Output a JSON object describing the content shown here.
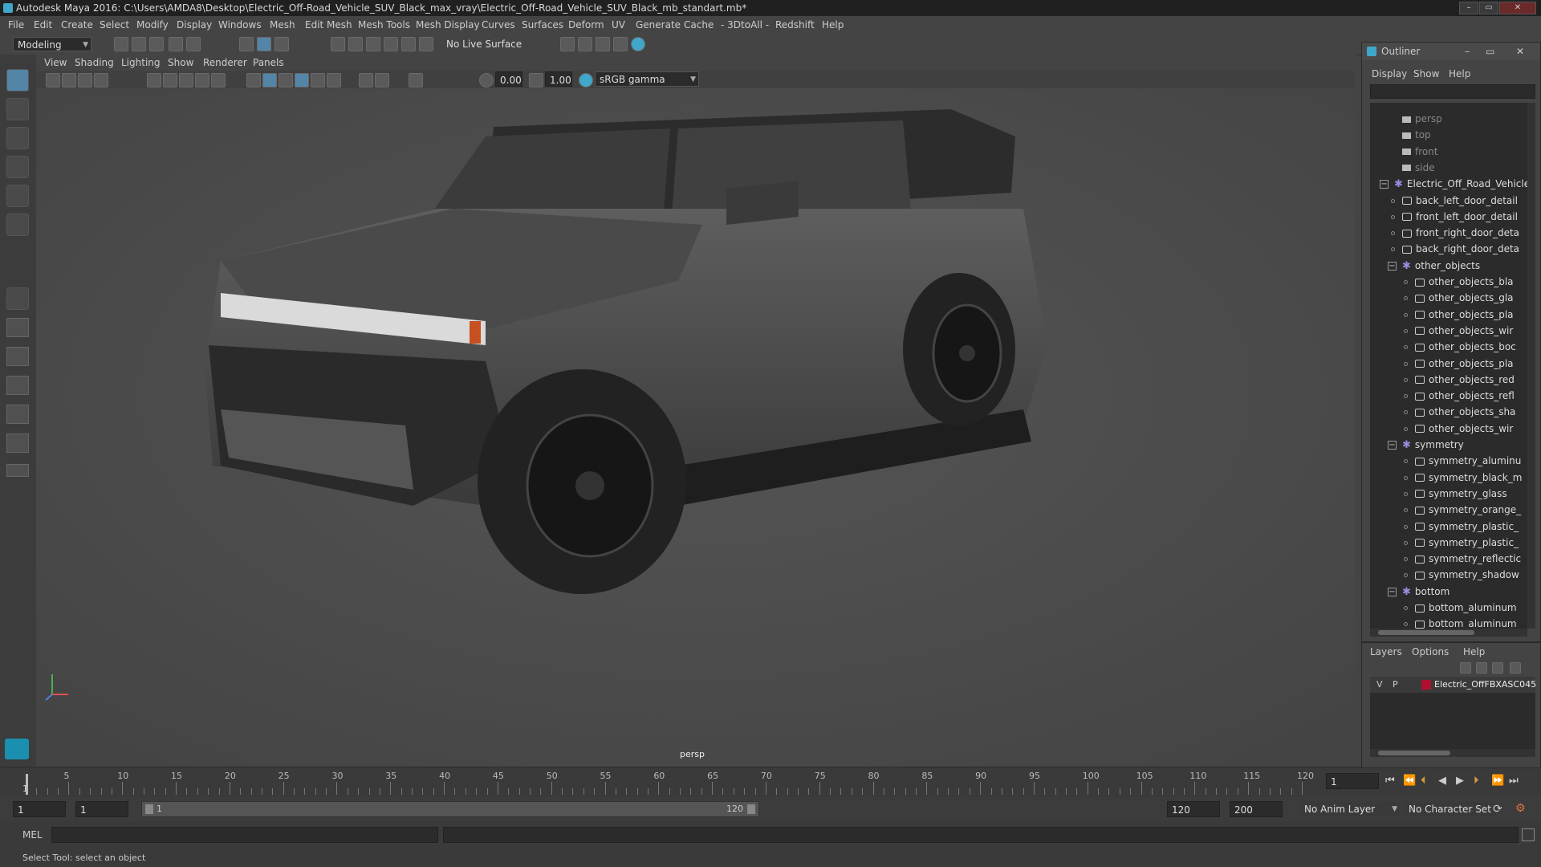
{
  "window": {
    "title": "Autodesk Maya 2016: C:\\Users\\AMDA8\\Desktop\\Electric_Off-Road_Vehicle_SUV_Black_max_vray\\Electric_Off-Road_Vehicle_SUV_Black_mb_standart.mb*"
  },
  "menu": [
    "File",
    "Edit",
    "Create",
    "Select",
    "Modify",
    "Display",
    "Windows",
    "Mesh",
    "Edit Mesh",
    "Mesh Tools",
    "Mesh Display",
    "Curves",
    "Surfaces",
    "Deform",
    "UV",
    "Generate",
    "Cache",
    "- 3DtoAll -",
    "Redshift",
    "Help"
  ],
  "shelf": {
    "mode": "Modeling",
    "live_surface": "No Live Surface"
  },
  "panel": {
    "menu": [
      "View",
      "Shading",
      "Lighting",
      "Show",
      "Renderer",
      "Panels"
    ],
    "exposure": "0.00",
    "gamma": "1.00",
    "colorspace": "sRGB gamma",
    "camera_label": "persp"
  },
  "timeline": {
    "ticks": [
      "5",
      "10",
      "15",
      "20",
      "25",
      "30",
      "35",
      "40",
      "45",
      "50",
      "55",
      "60",
      "65",
      "70",
      "75",
      "80",
      "85",
      "90",
      "95",
      "100",
      "105",
      "110",
      "115",
      "120"
    ],
    "tick_values": [
      5,
      10,
      15,
      20,
      25,
      30,
      35,
      40,
      45,
      50,
      55,
      60,
      65,
      70,
      75,
      80,
      85,
      90,
      95,
      100,
      105,
      110,
      115,
      120
    ],
    "range_min": 1,
    "range_max": 120,
    "start_label": "1",
    "current_frame": "1"
  },
  "range": {
    "start": "1",
    "inner_start": "1",
    "slider_start": "1",
    "slider_end": "120",
    "end": "120",
    "anim_end": "200",
    "anim_layer": "No Anim Layer",
    "char_set": "No Character Set"
  },
  "cmd": {
    "lang": "MEL"
  },
  "help": {
    "text": "Select Tool: select an object"
  },
  "outliner": {
    "title": "Outliner",
    "menu": [
      "Display",
      "Show",
      "Help"
    ],
    "items": [
      {
        "label": "persp",
        "type": "camera",
        "depth": 1,
        "dim": true
      },
      {
        "label": "top",
        "type": "camera",
        "depth": 1,
        "dim": true
      },
      {
        "label": "front",
        "type": "camera",
        "depth": 1,
        "dim": true
      },
      {
        "label": "side",
        "type": "camera",
        "depth": 1,
        "dim": true
      },
      {
        "label": "Electric_Off_Road_Vehicle",
        "type": "group",
        "depth": 0,
        "exp": "−"
      },
      {
        "label": "back_left_door_detail",
        "type": "mesh",
        "depth": 1
      },
      {
        "label": "front_left_door_detail",
        "type": "mesh",
        "depth": 1
      },
      {
        "label": "front_right_door_deta",
        "type": "mesh",
        "depth": 1
      },
      {
        "label": "back_right_door_deta",
        "type": "mesh",
        "depth": 1
      },
      {
        "label": "other_objects",
        "type": "group",
        "depth": 1,
        "exp": "−"
      },
      {
        "label": "other_objects_bla",
        "type": "mesh",
        "depth": 2
      },
      {
        "label": "other_objects_gla",
        "type": "mesh",
        "depth": 2
      },
      {
        "label": "other_objects_pla",
        "type": "mesh",
        "depth": 2
      },
      {
        "label": "other_objects_wir",
        "type": "mesh",
        "depth": 2
      },
      {
        "label": "other_objects_boc",
        "type": "mesh",
        "depth": 2
      },
      {
        "label": "other_objects_pla",
        "type": "mesh",
        "depth": 2
      },
      {
        "label": "other_objects_red",
        "type": "mesh",
        "depth": 2
      },
      {
        "label": "other_objects_refl",
        "type": "mesh",
        "depth": 2
      },
      {
        "label": "other_objects_sha",
        "type": "mesh",
        "depth": 2
      },
      {
        "label": "other_objects_wir",
        "type": "mesh",
        "depth": 2
      },
      {
        "label": "symmetry",
        "type": "group",
        "depth": 1,
        "exp": "−"
      },
      {
        "label": "symmetry_aluminu",
        "type": "mesh",
        "depth": 2
      },
      {
        "label": "symmetry_black_m",
        "type": "mesh",
        "depth": 2
      },
      {
        "label": "symmetry_glass",
        "type": "mesh",
        "depth": 2
      },
      {
        "label": "symmetry_orange_",
        "type": "mesh",
        "depth": 2
      },
      {
        "label": "symmetry_plastic_",
        "type": "mesh",
        "depth": 2
      },
      {
        "label": "symmetry_plastic_",
        "type": "mesh",
        "depth": 2
      },
      {
        "label": "symmetry_reflectic",
        "type": "mesh",
        "depth": 2
      },
      {
        "label": "symmetry_shadow",
        "type": "mesh",
        "depth": 2
      },
      {
        "label": "bottom",
        "type": "group",
        "depth": 1,
        "exp": "−"
      },
      {
        "label": "bottom_aluminum",
        "type": "mesh",
        "depth": 2
      },
      {
        "label": "bottom_aluminum",
        "type": "mesh",
        "depth": 2
      }
    ]
  },
  "layers": {
    "menu": [
      "Layers",
      "Options",
      "Help"
    ],
    "row": {
      "v": "V",
      "p": "P",
      "name": "Electric_OffFBXASC045",
      "color": "#b01030"
    }
  },
  "colors": {
    "accent": "#5285a6",
    "panel": "#444444",
    "field": "#2b2b2b"
  }
}
